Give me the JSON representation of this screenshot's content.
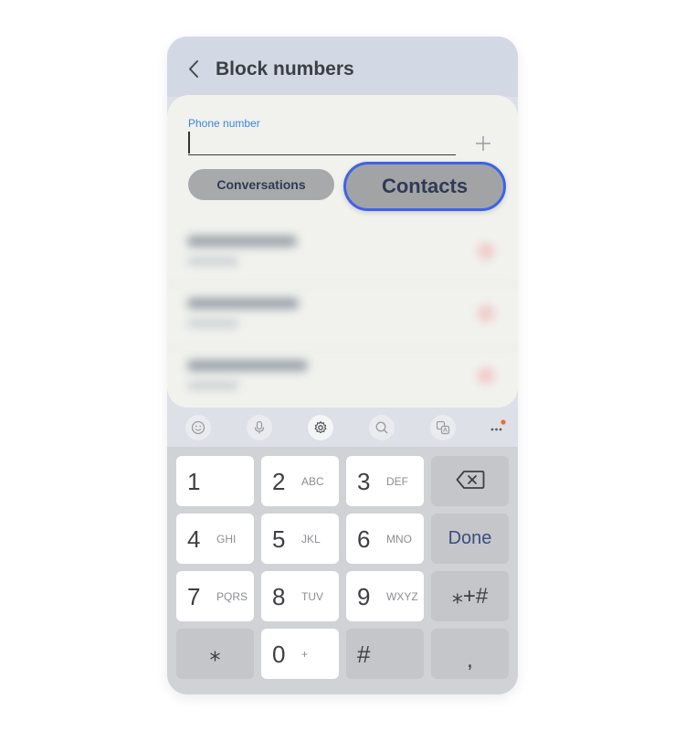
{
  "header": {
    "title": "Block numbers"
  },
  "form": {
    "phone_label": "Phone number",
    "phone_value": ""
  },
  "buttons": {
    "conversations": "Conversations",
    "contacts": "Contacts"
  },
  "keypad": {
    "rows": [
      [
        {
          "main": "1",
          "sub": ""
        },
        {
          "main": "2",
          "sub": "ABC"
        },
        {
          "main": "3",
          "sub": "DEF"
        }
      ],
      [
        {
          "main": "4",
          "sub": "GHI"
        },
        {
          "main": "5",
          "sub": "JKL"
        },
        {
          "main": "6",
          "sub": "MNO"
        }
      ],
      [
        {
          "main": "7",
          "sub": "PQRS"
        },
        {
          "main": "8",
          "sub": "TUV"
        },
        {
          "main": "9",
          "sub": "WXYZ"
        }
      ]
    ],
    "done": "Done",
    "star_plus_hash": "⁎+#",
    "star": "⁎",
    "zero": "0",
    "zero_sub": "+",
    "hash": "#",
    "comma": ","
  },
  "colors": {
    "accent": "#3d63e8",
    "label_blue": "#3b86d4",
    "toolbar_notification": "#f06a2e"
  },
  "icons": [
    "back-arrow-icon",
    "plus-icon",
    "emoji-icon",
    "microphone-icon",
    "settings-icon",
    "search-icon",
    "translate-icon",
    "more-icon",
    "backspace-icon"
  ]
}
